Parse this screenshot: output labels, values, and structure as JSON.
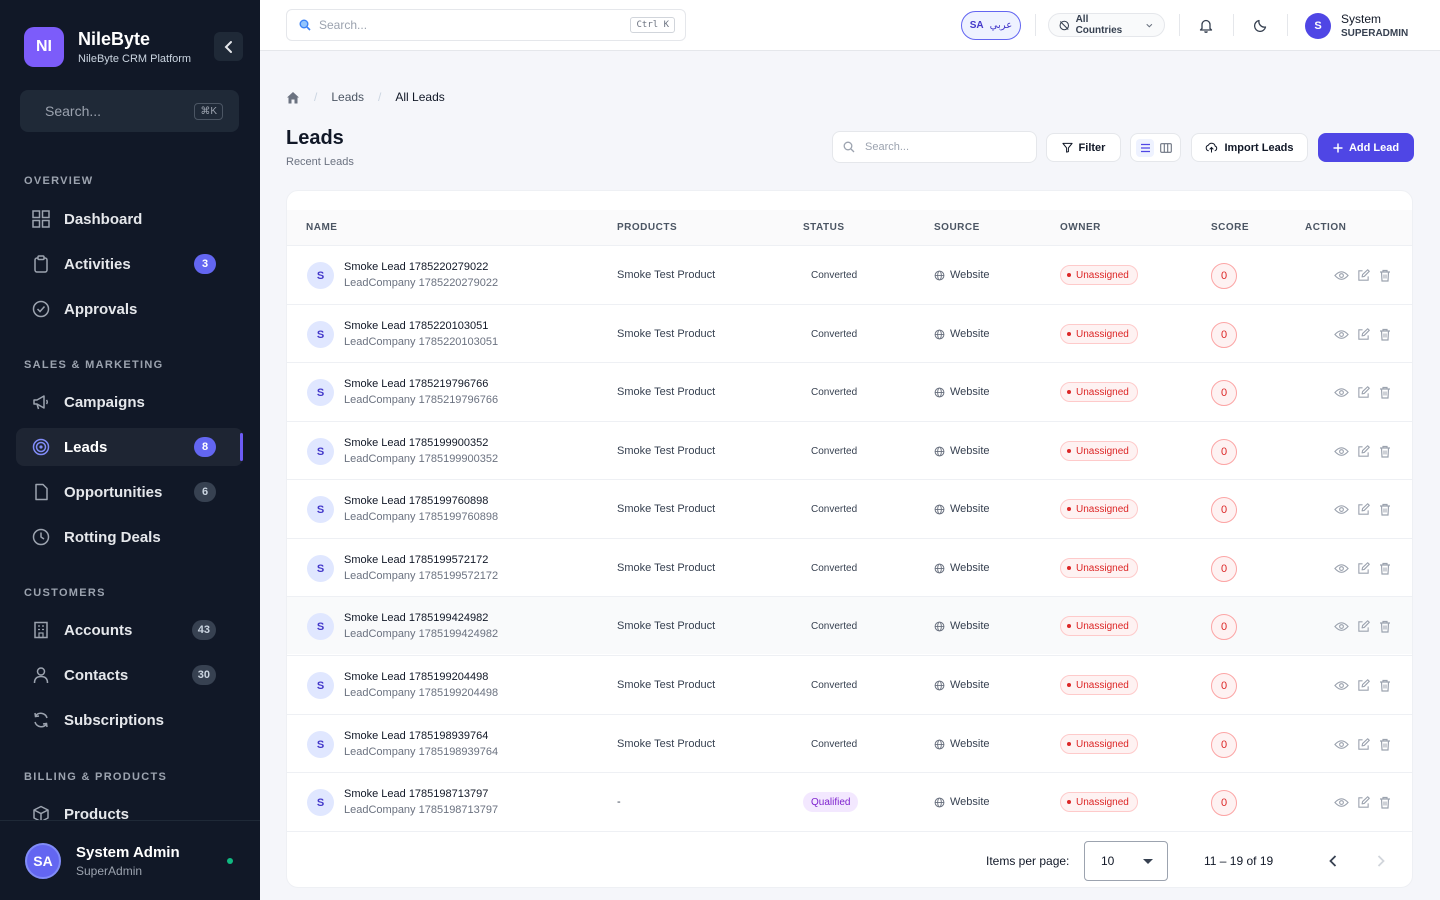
{
  "sidebar": {
    "logo": "NI",
    "brand_name": "NileByte",
    "brand_sub": "NileByte CRM Platform",
    "search_placeholder": "Search...",
    "search_shortcut": "⌘K",
    "sections": {
      "overview": "OVERVIEW",
      "sales": "SALES & MARKETING",
      "customers": "CUSTOMERS",
      "billing": "BILLING & PRODUCTS"
    },
    "items": {
      "dashboard": {
        "label": "Dashboard"
      },
      "activities": {
        "label": "Activities",
        "badge": "3"
      },
      "approvals": {
        "label": "Approvals"
      },
      "campaigns": {
        "label": "Campaigns"
      },
      "leads": {
        "label": "Leads",
        "badge": "8"
      },
      "opportunities": {
        "label": "Opportunities",
        "badge": "6"
      },
      "rotting": {
        "label": "Rotting Deals"
      },
      "accounts": {
        "label": "Accounts",
        "badge": "43"
      },
      "contacts": {
        "label": "Contacts",
        "badge": "30"
      },
      "subscriptions": {
        "label": "Subscriptions"
      },
      "products": {
        "label": "Products"
      }
    },
    "footer": {
      "initials": "SA",
      "name": "System Admin",
      "role": "SuperAdmin"
    }
  },
  "topbar": {
    "search_placeholder": "Search...",
    "search_shortcut": "Ctrl K",
    "lang_code": "SA",
    "lang_label": "عربي",
    "country": "All Countries",
    "user_initial": "S",
    "user_name": "System",
    "user_role": "SUPERADMIN"
  },
  "breadcrumb": {
    "leads": "Leads",
    "current": "All Leads"
  },
  "page": {
    "title": "Leads",
    "subtitle": "Recent Leads",
    "search_placeholder": "Search...",
    "filter_label": "Filter",
    "import_label": "Import Leads",
    "add_label": "Add Lead"
  },
  "table": {
    "columns": {
      "name": "NAME",
      "products": "PRODUCTS",
      "status": "STATUS",
      "source": "SOURCE",
      "owner": "OWNER",
      "score": "SCORE",
      "action": "ACTION"
    },
    "rows": [
      {
        "initial": "S",
        "name": "Smoke Lead 1785220279022",
        "company": "LeadCompany 1785220279022",
        "product": "Smoke Test Product",
        "status": "Converted",
        "source": "Website",
        "owner": "Unassigned",
        "score": "0"
      },
      {
        "initial": "S",
        "name": "Smoke Lead 1785220103051",
        "company": "LeadCompany 1785220103051",
        "product": "Smoke Test Product",
        "status": "Converted",
        "source": "Website",
        "owner": "Unassigned",
        "score": "0"
      },
      {
        "initial": "S",
        "name": "Smoke Lead 1785219796766",
        "company": "LeadCompany 1785219796766",
        "product": "Smoke Test Product",
        "status": "Converted",
        "source": "Website",
        "owner": "Unassigned",
        "score": "0"
      },
      {
        "initial": "S",
        "name": "Smoke Lead 1785199900352",
        "company": "LeadCompany 1785199900352",
        "product": "Smoke Test Product",
        "status": "Converted",
        "source": "Website",
        "owner": "Unassigned",
        "score": "0"
      },
      {
        "initial": "S",
        "name": "Smoke Lead 1785199760898",
        "company": "LeadCompany 1785199760898",
        "product": "Smoke Test Product",
        "status": "Converted",
        "source": "Website",
        "owner": "Unassigned",
        "score": "0"
      },
      {
        "initial": "S",
        "name": "Smoke Lead 1785199572172",
        "company": "LeadCompany 1785199572172",
        "product": "Smoke Test Product",
        "status": "Converted",
        "source": "Website",
        "owner": "Unassigned",
        "score": "0"
      },
      {
        "initial": "S",
        "name": "Smoke Lead 1785199424982",
        "company": "LeadCompany 1785199424982",
        "product": "Smoke Test Product",
        "status": "Converted",
        "source": "Website",
        "owner": "Unassigned",
        "score": "0"
      },
      {
        "initial": "S",
        "name": "Smoke Lead 1785199204498",
        "company": "LeadCompany 1785199204498",
        "product": "Smoke Test Product",
        "status": "Converted",
        "source": "Website",
        "owner": "Unassigned",
        "score": "0"
      },
      {
        "initial": "S",
        "name": "Smoke Lead 1785198939764",
        "company": "LeadCompany 1785198939764",
        "product": "Smoke Test Product",
        "status": "Converted",
        "source": "Website",
        "owner": "Unassigned",
        "score": "0"
      },
      {
        "initial": "S",
        "name": "Smoke Lead 1785198713797",
        "company": "LeadCompany 1785198713797",
        "product": "-",
        "status": "Qualified",
        "source": "Website",
        "owner": "Unassigned",
        "score": "0"
      }
    ]
  },
  "pagination": {
    "items_per_page_label": "Items per page:",
    "page_size": "10",
    "range": "11 – 19 of 19"
  },
  "colors": {
    "sidebar_bg": "#111827",
    "accent": "#4f46e5",
    "danger": "#dc2626",
    "qualified": "#7e22ce"
  }
}
